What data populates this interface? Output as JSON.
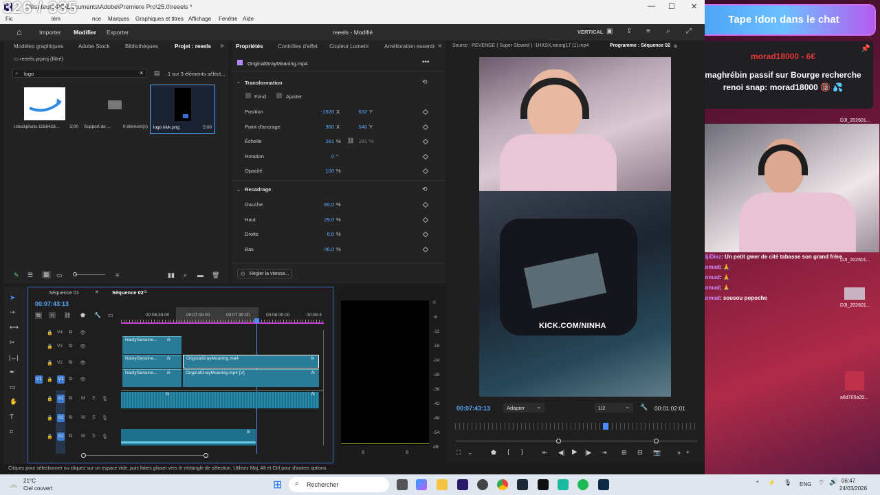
{
  "window": {
    "counter": "326 / 335",
    "title": "...tilisateurs\\PC\\Documents\\Adobe\\Premiere Pro\\25.0\\reeels *",
    "file_menu": "Fic",
    "menu": [
      "lém",
      "nce",
      "Marques",
      "Graphiques et titres",
      "Affichage",
      "Fenêtre",
      "Aide"
    ]
  },
  "topnav": {
    "home_icon": "home-icon",
    "items": [
      "Importer",
      "Modifier",
      "Exporter"
    ],
    "project_title": "reeels - Modifié",
    "workspace": "VERTICAL"
  },
  "project_panel": {
    "tabs": [
      "Modèles graphiques",
      "Adobe Stock",
      "Bibliothèques",
      "Projet : reeels"
    ],
    "file": "reeels.prproj (filtré)",
    "search_value": "logo",
    "count": "1 sur 3 éléments sélect...",
    "items": [
      {
        "name": "istockphoto-1166428...",
        "duration": "5:00"
      },
      {
        "name": "Support de ...",
        "duration": "0 élément(s)"
      },
      {
        "name": "logo kivk.png",
        "duration": "5:00"
      }
    ]
  },
  "properties_panel": {
    "tabs": [
      "Propriétés",
      "Contrôles d'effet",
      "Couleur Lumetri",
      "Amélioration essentiel"
    ],
    "clip_name": "OriginalGrayMoaning.mp4",
    "transformation_label": "Transformation",
    "fill_label": "Fond",
    "adjust_label": "Ajuster",
    "transform_rows": [
      {
        "label": "Position",
        "v1": "-1620",
        "u1": "X",
        "v2": "632",
        "u2": "Y"
      },
      {
        "label": "Point d'ancrage",
        "v1": "960",
        "u1": "X",
        "v2": "540",
        "u2": "Y"
      },
      {
        "label": "Échelle",
        "v1": "281",
        "u1": "%",
        "v2": "281",
        "u2": "%"
      },
      {
        "label": "Rotation",
        "v1": "0",
        "u1": "°",
        "v2": "",
        "u2": ""
      },
      {
        "label": "Opacité",
        "v1": "100",
        "u1": "%",
        "v2": "",
        "u2": ""
      }
    ],
    "crop_label": "Recadrage",
    "crop_rows": [
      {
        "label": "Gauche",
        "value": "80,0",
        "unit": "%"
      },
      {
        "label": "Haut",
        "value": "29,0",
        "unit": "%"
      },
      {
        "label": "Droite",
        "value": "0,0",
        "unit": "%"
      },
      {
        "label": "Bas",
        "value": "46,0",
        "unit": "%"
      }
    ],
    "speed_button": "Régler la vitesse..."
  },
  "program_monitor": {
    "source_tab": "Source : REVENGE ( Super Slowed ) -1HXSX,wnorg17 (1).mp4",
    "program_tab": "Programme : Séquence 02",
    "overlay_text": "KICK.COM/NINHA",
    "timecode": "00:07:43:13",
    "fit": "Adapter",
    "resolution": "1/2",
    "duration": "00:01:02:01"
  },
  "timeline": {
    "tabs": [
      "Séquence 01",
      "Séquence 02"
    ],
    "timecode": "00:07:43:13",
    "ruler": [
      "00:06:30:00",
      "00:07:00:00",
      "00:07:30:00",
      "00:08:00:00",
      "00:08:3"
    ],
    "video_tracks": [
      "V4",
      "V3",
      "V2",
      "V1"
    ],
    "audio_tracks": [
      "A1",
      "A2",
      "A3"
    ],
    "clips": {
      "v3_a": "NastyGenuine...",
      "v2_a": "NastyGenuine...",
      "v2_b": "OriginalGrayMoaning.mp4",
      "v1_a": "NastyGenuine...",
      "v1_b": "OriginalGrayMoaning.mp4 [V]"
    },
    "fx": "fx",
    "meter_scale": [
      "0",
      "-6",
      "-12",
      "-18",
      "-24",
      "-30",
      "-36",
      "-42",
      "-48",
      "-54",
      "dB"
    ],
    "meter_foot": [
      "S",
      "S"
    ]
  },
  "status_bar": "Cliquez pour sélectionner ou cliquez sur un espace vide, puis faites glisser vers le rectangle de sélection. Utilisez Maj, Alt et Ctrl pour d'autres options.",
  "stream_overlay": {
    "banner": "Tape !don dans le chat",
    "donation_title": "morad18000 - 6€",
    "donation_message": "maghrébin passif sur Bourge recherche renoi snap: morad18000 🔞 💦",
    "desktop_icons": [
      "DJI_202601...",
      "DJI_202601...",
      "DJI_202601...",
      "a6d705a39..."
    ],
    "chat": [
      {
        "user": "TidjiDiez",
        "text": ": Un petit gwer de cité tabasse son grand frère"
      },
      {
        "user": "Yanmad",
        "text": ": 🙏"
      },
      {
        "user": "Yanmad",
        "text": ": 🙏"
      },
      {
        "user": "Yanmad",
        "text": ": 🙏"
      },
      {
        "user": "Yanmad",
        "text": ": sousou popoche"
      }
    ]
  },
  "taskbar": {
    "temp": "21°C",
    "weather": "Ciel couvert",
    "search": "Rechercher",
    "lang": "ENG",
    "time": "06:47",
    "date": "24/03/2026"
  },
  "colors": {
    "accent_blue": "#5aa7ff",
    "clip_teal": "#2a7b97",
    "playhead": "#4a8cff",
    "banner_gradient": "#4aa0f5"
  }
}
